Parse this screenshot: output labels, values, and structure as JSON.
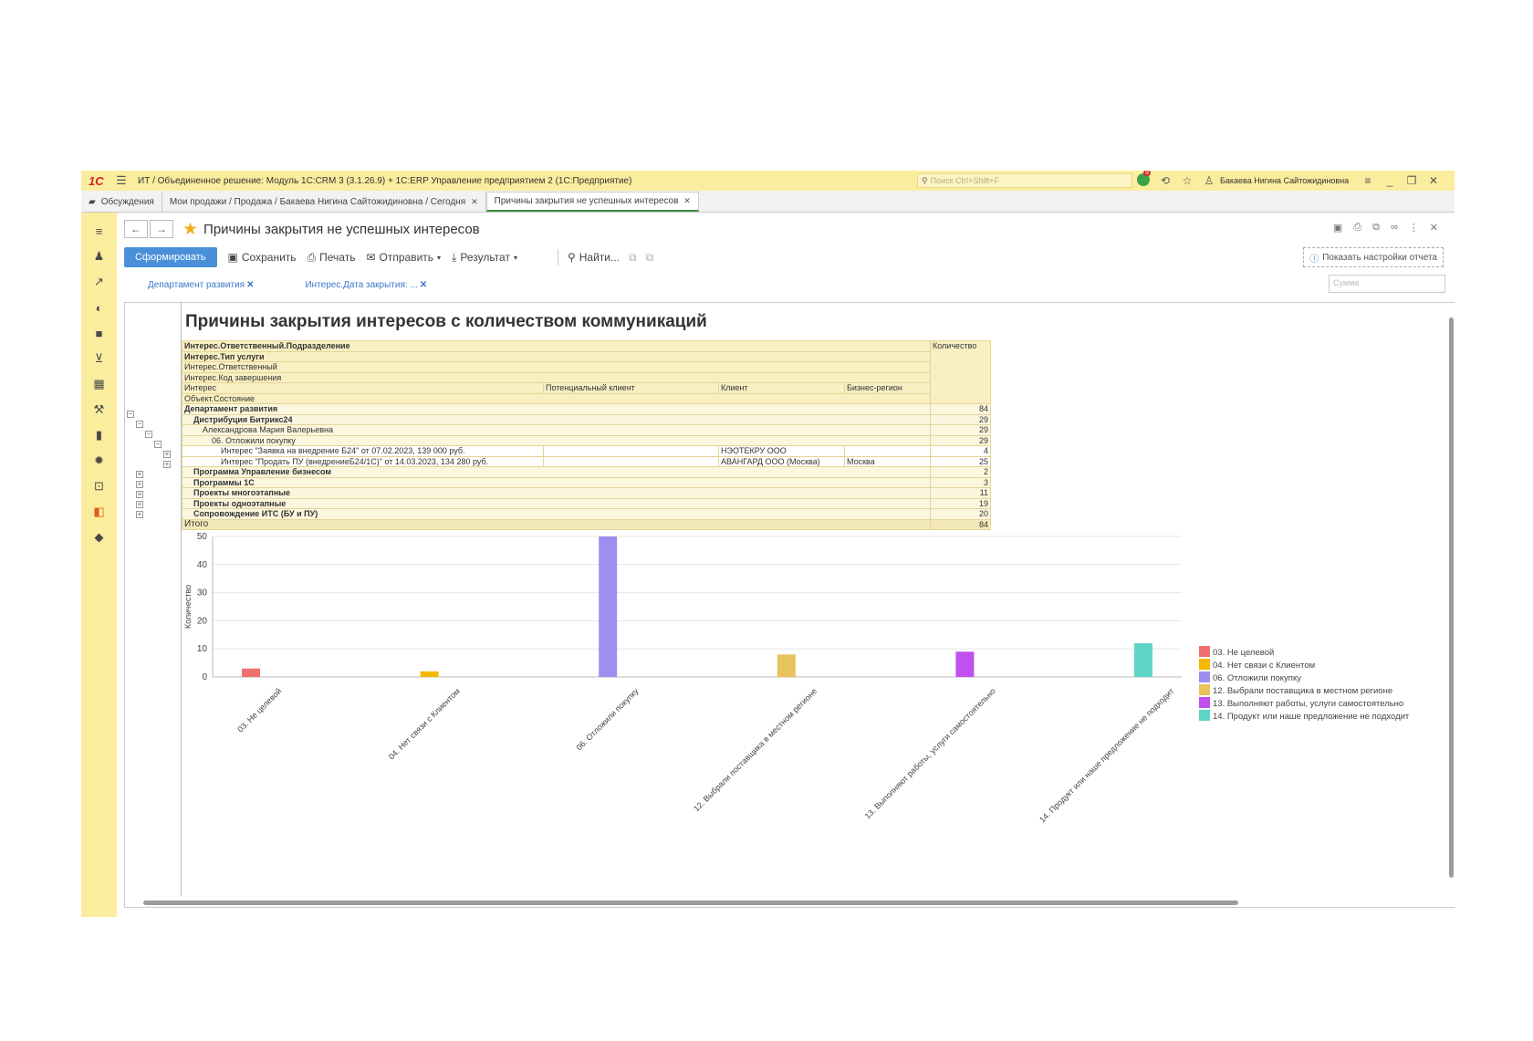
{
  "titlebar": {
    "app_title": "ИТ / Объединенное решение: Модуль 1С:CRM 3 (3.1.26.9) + 1С:ERP Управление предприятием 2  (1С:Предприятие)",
    "search_placeholder": "Поиск Ctrl+Shift+F",
    "notification_count": "9",
    "user": "Бакаева Нигина Сайтожидиновна"
  },
  "tabs": [
    {
      "label": "Обсуждения"
    },
    {
      "label": "Мои продажи / Продажа / Бакаева Нигина Сайтожидиновна / Сегодня"
    },
    {
      "label": "Причины закрытия не успешных интересов"
    }
  ],
  "page": {
    "title": "Причины закрытия не успешных интересов"
  },
  "toolbar": {
    "generate": "Сформировать",
    "save": "Сохранить",
    "print": "Печать",
    "send": "Отправить",
    "result": "Результат",
    "find": "Найти...",
    "settings": "Показать настройки отчета"
  },
  "filters": [
    {
      "label": "Департамент развития"
    },
    {
      "label": "Интерес.Дата закрытия: ..."
    }
  ],
  "sum_placeholder": "Сумма",
  "report": {
    "title": "Причины закрытия интересов с количеством коммуникаций",
    "header_rows": [
      "Интерес.Ответственный.Подразделение",
      "Интерес.Тип услуги",
      "Интерес.Ответственный",
      "Интерес.Код завершения"
    ],
    "col_interest": "Интерес",
    "col_potential_client": "Потенциальный клиент",
    "col_client": "Клиент",
    "col_region": "Бизнес-регион",
    "col_object_state": "Объект.Состояние",
    "col_quantity": "Количество",
    "rows": {
      "r1": {
        "label": "Департамент развития",
        "value": "84"
      },
      "r2": {
        "label": "Дистрибуция Битрикс24",
        "value": "29"
      },
      "r3": {
        "label": "Александрова Мария Валерьевна",
        "value": "29"
      },
      "r4": {
        "label": "06. Отложили покупку",
        "value": "29"
      },
      "r5": {
        "label": "Интерес \"Заявка на внедрение Б24\" от 07.02.2023, 139 000 руб.",
        "client": "НЭОТЕКРУ ООО",
        "region": "",
        "value": "4"
      },
      "r6": {
        "label": "Интерес \"Продать ПУ (внедрениеБ24/1С)\" от 14.03.2023, 134 280 руб.",
        "client": "АВАНГАРД ООО (Москва)",
        "region": "Москва",
        "value": "25"
      },
      "r7": {
        "label": "Программа Управление бизнесом",
        "value": "2"
      },
      "r8": {
        "label": "Программы 1С",
        "value": "3"
      },
      "r9": {
        "label": "Проекты многоэтапные",
        "value": "11"
      },
      "r10": {
        "label": "Проекты одноэтапные",
        "value": "19"
      },
      "r11": {
        "label": "Сопровождение ИТС (БУ и ПУ)",
        "value": "20"
      }
    },
    "total": {
      "label": "Итого",
      "value": "84"
    }
  },
  "chart_data": {
    "type": "bar",
    "ylabel": "Количество",
    "ylim": [
      0,
      50
    ],
    "yticks": [
      0,
      10,
      20,
      30,
      40,
      50
    ],
    "grid": true,
    "legend": "right",
    "categories": [
      "03. Не целевой",
      "04. Нет связи с Клиентом",
      "06. Отложили покупку",
      "12. Выбрали поставщика в местном регионе",
      "13. Выполняют работы, услуги самостоятельно",
      "14. Продукт или наше предложение не подходит"
    ],
    "values": [
      3,
      2,
      50,
      8,
      9,
      12
    ],
    "colors": [
      "#f07070",
      "#f5b800",
      "#9b8ff0",
      "#e8c25a",
      "#c050f0",
      "#5fd3c8"
    ]
  }
}
